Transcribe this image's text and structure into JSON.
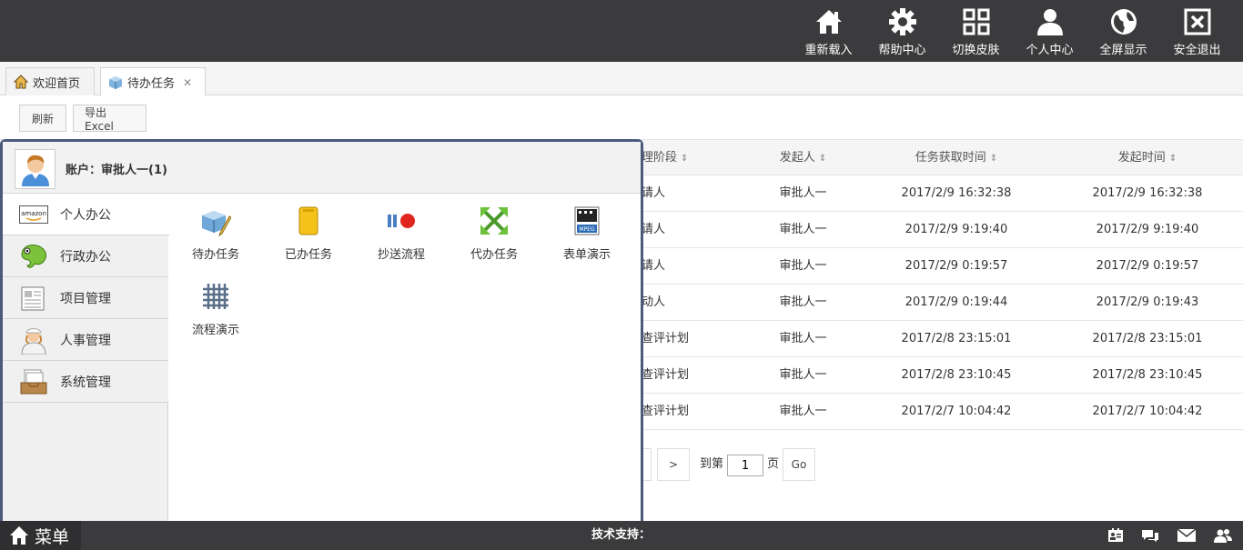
{
  "topnav": [
    {
      "label": "重新载入",
      "icon": "home-icon"
    },
    {
      "label": "帮助中心",
      "icon": "gear-icon"
    },
    {
      "label": "切换皮肤",
      "icon": "grid-icon"
    },
    {
      "label": "个人中心",
      "icon": "user-icon"
    },
    {
      "label": "全屏显示",
      "icon": "globe-icon"
    },
    {
      "label": "安全退出",
      "icon": "close-box-icon"
    }
  ],
  "tabs": [
    {
      "label": "欢迎首页",
      "icon": "home-tab-icon"
    },
    {
      "label": "待办任务",
      "icon": "cube-tab-icon",
      "close": "✕"
    }
  ],
  "toolbar": {
    "refresh": "刷新",
    "export": "导出Excel"
  },
  "grid": {
    "headers": {
      "stage": "理阶段",
      "initiator": "发起人",
      "fetch_time": "任务获取时间",
      "start_time": "发起时间"
    },
    "sort_glyph": "⇕",
    "rows": [
      {
        "stage": "请人",
        "initiator": "审批人一",
        "fetch_time": "2017/2/9 16:32:38",
        "start_time": "2017/2/9 16:32:38"
      },
      {
        "stage": "请人",
        "initiator": "审批人一",
        "fetch_time": "2017/2/9 9:19:40",
        "start_time": "2017/2/9 9:19:40"
      },
      {
        "stage": "请人",
        "initiator": "审批人一",
        "fetch_time": "2017/2/9 0:19:57",
        "start_time": "2017/2/9 0:19:57"
      },
      {
        "stage": "动人",
        "initiator": "审批人一",
        "fetch_time": "2017/2/9 0:19:44",
        "start_time": "2017/2/9 0:19:43"
      },
      {
        "stage": "查评计划",
        "initiator": "审批人一",
        "fetch_time": "2017/2/8 23:15:01",
        "start_time": "2017/2/8 23:15:01"
      },
      {
        "stage": "查评计划",
        "initiator": "审批人一",
        "fetch_time": "2017/2/8 23:10:45",
        "start_time": "2017/2/8 23:10:45"
      },
      {
        "stage": "查评计划",
        "initiator": "审批人一",
        "fetch_time": "2017/2/7 10:04:42",
        "start_time": "2017/2/7 10:04:42"
      }
    ]
  },
  "pager": {
    "next": ">",
    "goto_prefix": "到第",
    "page_value": "1",
    "goto_suffix": "页",
    "go": "Go"
  },
  "startmenu": {
    "account": "账户：审批人一(1)",
    "side": [
      {
        "label": "个人办公",
        "icon": "amazon-icon"
      },
      {
        "label": "行政办公",
        "icon": "chameleon-icon"
      },
      {
        "label": "项目管理",
        "icon": "newspaper-icon"
      },
      {
        "label": "人事管理",
        "icon": "nurse-icon"
      },
      {
        "label": "系统管理",
        "icon": "inbox-icon"
      }
    ],
    "apps": [
      {
        "label": "待办任务",
        "icon": "cube-pencil-icon"
      },
      {
        "label": "已办任务",
        "icon": "yellow-phone-icon"
      },
      {
        "label": "抄送流程",
        "icon": "record-icon"
      },
      {
        "label": "代办任务",
        "icon": "expand-arrows-icon"
      },
      {
        "label": "表单演示",
        "icon": "mpeg-icon"
      },
      {
        "label": "流程演示",
        "icon": "hash-grid-icon"
      }
    ]
  },
  "statusbar": {
    "menu": "菜单",
    "tech": "技术支持："
  }
}
